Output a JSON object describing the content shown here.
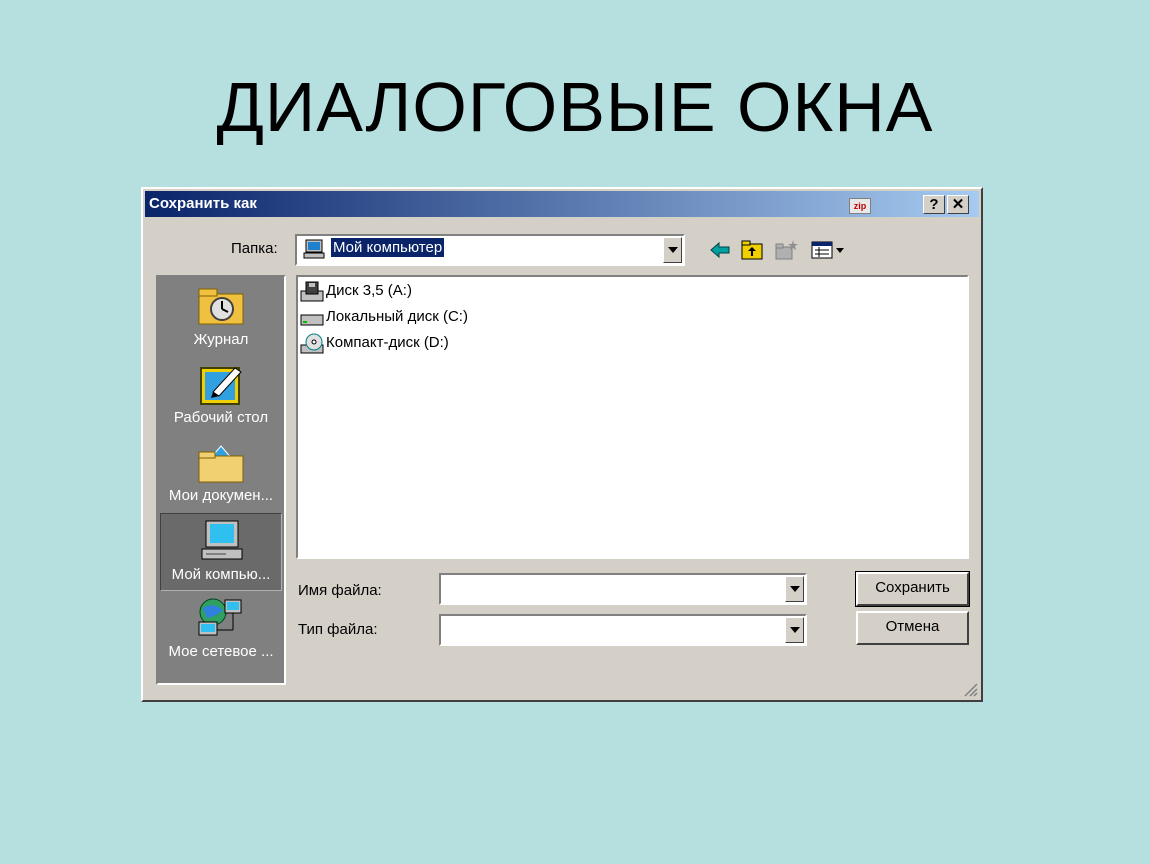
{
  "slide": {
    "title": "ДИАЛОГОВЫЕ ОКНА"
  },
  "dialog": {
    "title": "Сохранить как",
    "zip_label": "zip",
    "help_label": "?",
    "close_label": "✕",
    "folder": {
      "label": "Папка:",
      "value": "Мой компьютер"
    },
    "places": [
      {
        "label": "Журнал",
        "icon": "history-icon"
      },
      {
        "label": "Рабочий стол",
        "icon": "desktop-icon"
      },
      {
        "label": "Мои докумен...",
        "icon": "my-documents-icon"
      },
      {
        "label": "Мой компью...",
        "icon": "my-computer-icon",
        "selected": true
      },
      {
        "label": "Мое сетевое ...",
        "icon": "network-icon"
      }
    ],
    "files": [
      {
        "label": "Диск 3,5 (A:)",
        "icon": "floppy-drive-icon"
      },
      {
        "label": "Локальный диск (C:)",
        "icon": "hard-drive-icon"
      },
      {
        "label": "Компакт-диск (D:)",
        "icon": "cd-drive-icon"
      }
    ],
    "filename": {
      "label": "Имя файла:",
      "value": ""
    },
    "filetype": {
      "label": "Тип файла:",
      "value": ""
    },
    "buttons": {
      "save": "Сохранить",
      "cancel": "Отмена"
    }
  },
  "colors": {
    "background": "#b6e0e0",
    "titlebar_start": "#0a246a",
    "titlebar_end": "#a6caf0",
    "face": "#d4d0c8"
  }
}
